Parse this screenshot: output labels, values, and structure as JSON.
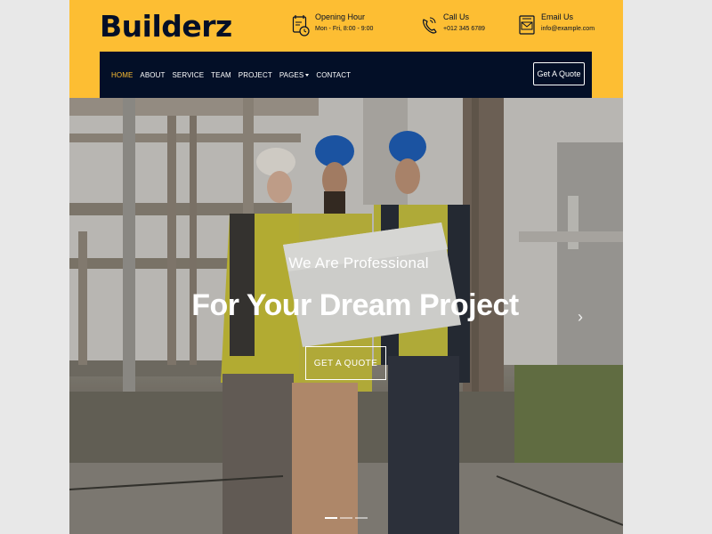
{
  "brand": {
    "logo": "Builderz"
  },
  "topbar": {
    "hours": {
      "icon": "clock-calendar-icon",
      "title": "Opening Hour",
      "value": "Mon - Fri, 8:00 - 9:00"
    },
    "call": {
      "icon": "phone-icon",
      "title": "Call Us",
      "value": "+012 345 6789"
    },
    "email": {
      "icon": "email-icon",
      "title": "Email Us",
      "value": "info@example.com"
    }
  },
  "nav": {
    "items": [
      {
        "label": "HOME",
        "active": true
      },
      {
        "label": "ABOUT"
      },
      {
        "label": "SERVICE"
      },
      {
        "label": "TEAM"
      },
      {
        "label": "PROJECT"
      },
      {
        "label": "PAGES",
        "dropdown": true
      },
      {
        "label": "CONTACT"
      }
    ],
    "cta": "Get A Quote"
  },
  "hero": {
    "subtitle": "We Are Professional",
    "title": "For Your Dream Project",
    "button": "GET A QUOTE",
    "next_icon": "chevron-right-icon",
    "slides": 3,
    "active_slide": 1
  },
  "colors": {
    "accent": "#fdbe33",
    "navy": "#030f27",
    "white": "#ffffff"
  }
}
